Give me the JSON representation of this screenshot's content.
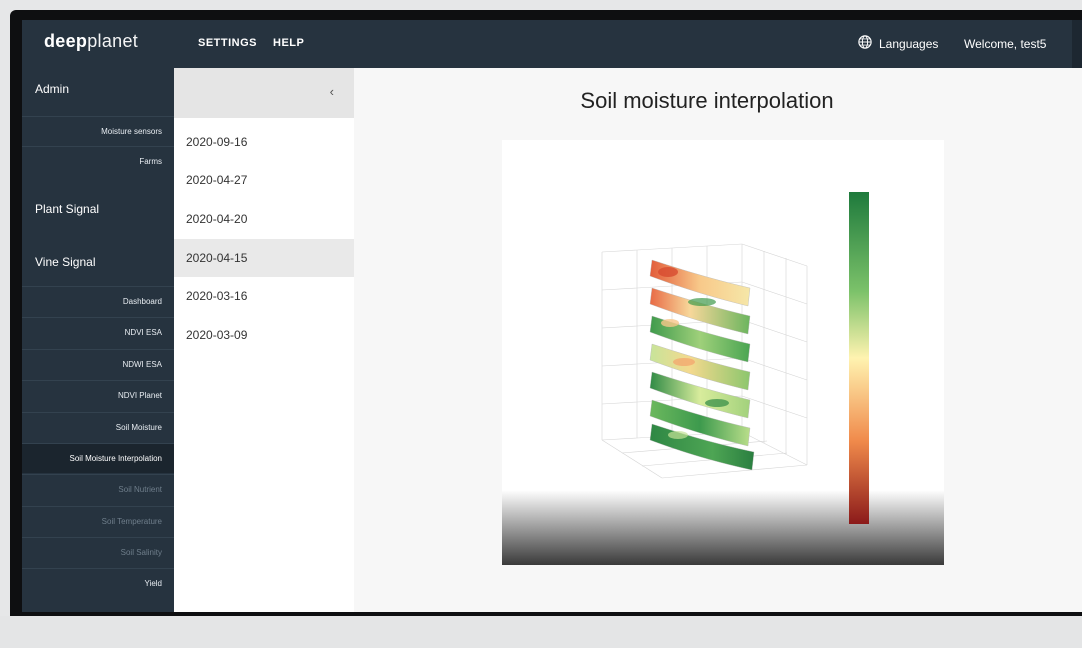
{
  "brand": {
    "logo_bold": "deep",
    "logo_light": "planet"
  },
  "topnav": {
    "settings": "SETTINGS",
    "help": "HELP",
    "languages": "Languages",
    "welcome": "Welcome, test5"
  },
  "sidebar": {
    "admin": "Admin",
    "admin_items": [
      "Moisture sensors",
      "Farms"
    ],
    "plant_signal": "Plant Signal",
    "vine_signal": "Vine Signal",
    "vine_items": [
      "Dashboard",
      "NDVI ESA",
      "NDWI ESA",
      "NDVI Planet",
      "Soil Moisture",
      "Soil Moisture Interpolation",
      "Soil Nutrient",
      "Soil Temperature",
      "Soil Salinity",
      "Yield"
    ],
    "active_item": "Soil Moisture Interpolation"
  },
  "dates": {
    "collapse_icon": "chevron-left-icon",
    "items": [
      "2020-09-16",
      "2020-04-27",
      "2020-04-20",
      "2020-04-15",
      "2020-03-16",
      "2020-03-09"
    ],
    "selected": "2020-04-15"
  },
  "main": {
    "title": "Soil moisture interpolation",
    "figure_type": "3D stacked soil moisture interpolation slices with vertical color bar (red = dry, green = wet)"
  },
  "colors": {
    "nav_bg": "#26333f",
    "active_bg": "#1b252e",
    "scale_dry": "#8b1a1a",
    "scale_mid": "#fff3b0",
    "scale_wet": "#1e7a3c"
  }
}
